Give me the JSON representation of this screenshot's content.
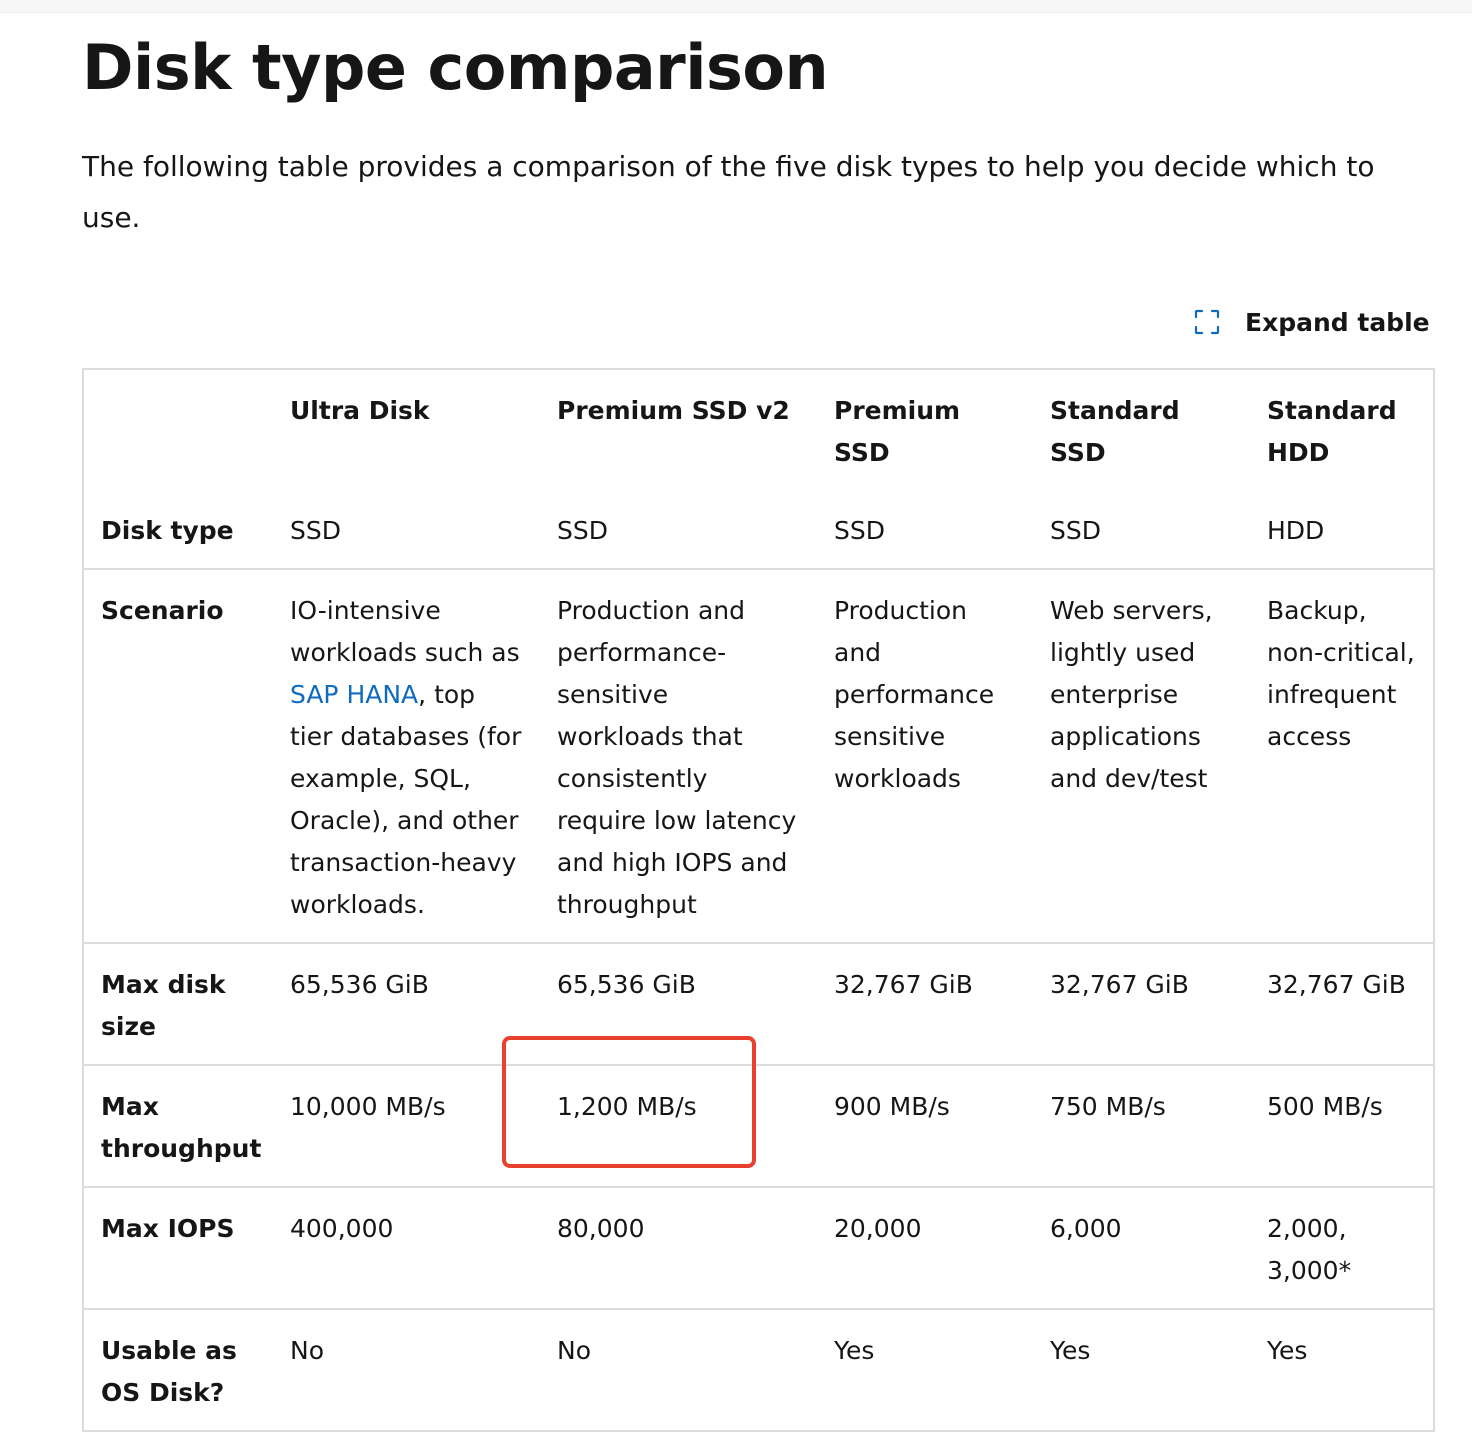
{
  "page": {
    "title": "Disk type comparison",
    "intro": "The following table provides a comparison of the five disk types to help you decide which to use.",
    "expand_label": "Expand table",
    "expand_icon": "expand-icon"
  },
  "table": {
    "headers": [
      "",
      "Ultra Disk",
      "Premium SSD v2",
      "Premium SSD",
      "Standard SSD",
      "Standard HDD"
    ],
    "rows": [
      {
        "label": "Disk type",
        "cells": [
          "SSD",
          "SSD",
          "SSD",
          "SSD",
          "HDD"
        ]
      },
      {
        "label": "Scenario",
        "cells": [
          {
            "before": "IO-intensive workloads such as ",
            "link": "SAP HANA",
            "after": ", top tier databases (for example, SQL, Oracle), and other transaction-heavy workloads."
          },
          "Production and performance-sensitive workloads that consistently require low latency and high IOPS and throughput",
          "Production and performance sensitive workloads",
          "Web servers, lightly used enterprise applications and dev/test",
          "Backup, non-critical, infrequent access"
        ]
      },
      {
        "label": "Max disk size",
        "cells": [
          "65,536 GiB",
          "65,536 GiB",
          "32,767 GiB",
          "32,767 GiB",
          "32,767 GiB"
        ]
      },
      {
        "label": "Max throughput",
        "cells": [
          "10,000 MB/s",
          "1,200 MB/s",
          "900 MB/s",
          "750 MB/s",
          "500 MB/s"
        ]
      },
      {
        "label": "Max IOPS",
        "cells": [
          "400,000",
          "80,000",
          "20,000",
          "6,000",
          "2,000, 3,000*"
        ]
      },
      {
        "label": "Usable as OS Disk?",
        "cells": [
          "No",
          "No",
          "Yes",
          "Yes",
          "Yes"
        ]
      }
    ]
  },
  "colors": {
    "link": "#0f6cbd",
    "highlight": "#e8412f",
    "border": "#dcdcdc",
    "text": "#161616"
  }
}
